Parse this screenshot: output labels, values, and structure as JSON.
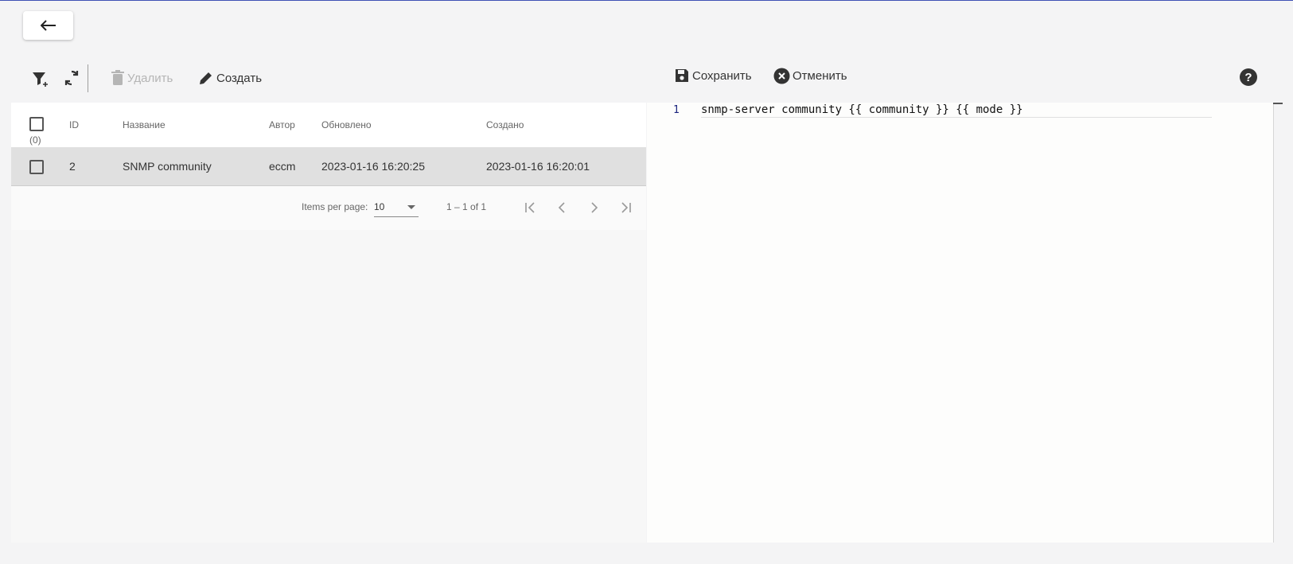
{
  "header": {
    "back_icon": "arrow-left-icon"
  },
  "toolbar_left": {
    "filter_icon": "filter-add-icon",
    "refresh_icon": "sync-icon",
    "delete_label": "Удалить",
    "delete_icon": "trash-icon",
    "create_label": "Создать",
    "create_icon": "pencil-icon"
  },
  "table": {
    "select_count": "(0)",
    "columns": [
      "ID",
      "Название",
      "Автор",
      "Обновлено",
      "Создано"
    ],
    "rows": [
      {
        "id": "2",
        "name": "SNMP community",
        "author": "eccm",
        "updated": "2023-01-16 16:20:25",
        "created": "2023-01-16 16:20:01"
      }
    ]
  },
  "paginator": {
    "items_per_page_label": "Items per page:",
    "page_size": "10",
    "range_label": "1 – 1 of 1"
  },
  "toolbar_right": {
    "save_label": "Сохранить",
    "save_icon": "floppy-disk-icon",
    "cancel_label": "Отменить",
    "cancel_icon": "close-circle-icon",
    "help_icon": "help-circle-icon",
    "help_glyph": "?"
  },
  "editor": {
    "lines": [
      {
        "number": "1",
        "text": "snmp-server community {{ community }} {{ mode }}"
      }
    ]
  },
  "colors": {
    "accent_line": "#3f51b5",
    "selected_row": "#e0e0e0",
    "line_number": "#1a237e"
  }
}
